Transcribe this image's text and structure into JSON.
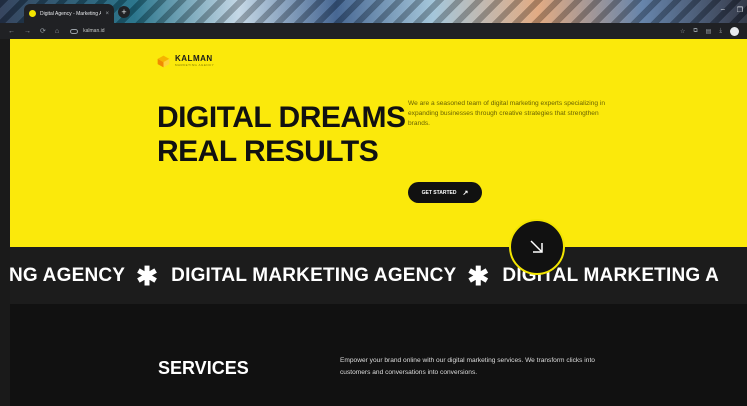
{
  "browser": {
    "tab_title": "Digital Agency - Marketing Ag",
    "tab_close": "×",
    "new_tab": "+",
    "window_controls": [
      "–",
      "❐"
    ],
    "url": "kalman.id",
    "nav": {
      "back": "←",
      "forward": "→",
      "reload": "⟳",
      "home": "⌂"
    },
    "toolbar_icons": {
      "bookmark": "☆",
      "extensions": "⧉",
      "reading": "▤",
      "downloads": "⤓"
    }
  },
  "hero": {
    "logo_name": "KALMAN",
    "logo_sub": "MARKETING AGENCY",
    "headline": [
      "DIGITAL DREAMS",
      "REAL RESULTS"
    ],
    "tagline": "We are a seasoned team of digital marketing experts specializing in expanding businesses through creative strategies that strengthen brands.",
    "cta_label": "GET STARTED",
    "cta_arrow": "↗",
    "accent_color": "#fbe90b"
  },
  "marquee": {
    "separator": "✱",
    "segments": [
      "NG AGENCY",
      "DIGITAL MARKETING AGENCY",
      "DIGITAL MARKETING A"
    ]
  },
  "services": {
    "title": "SERVICES",
    "description": "Empower your brand online with our digital marketing services. We transform clicks into customers and conversations into conversions."
  }
}
